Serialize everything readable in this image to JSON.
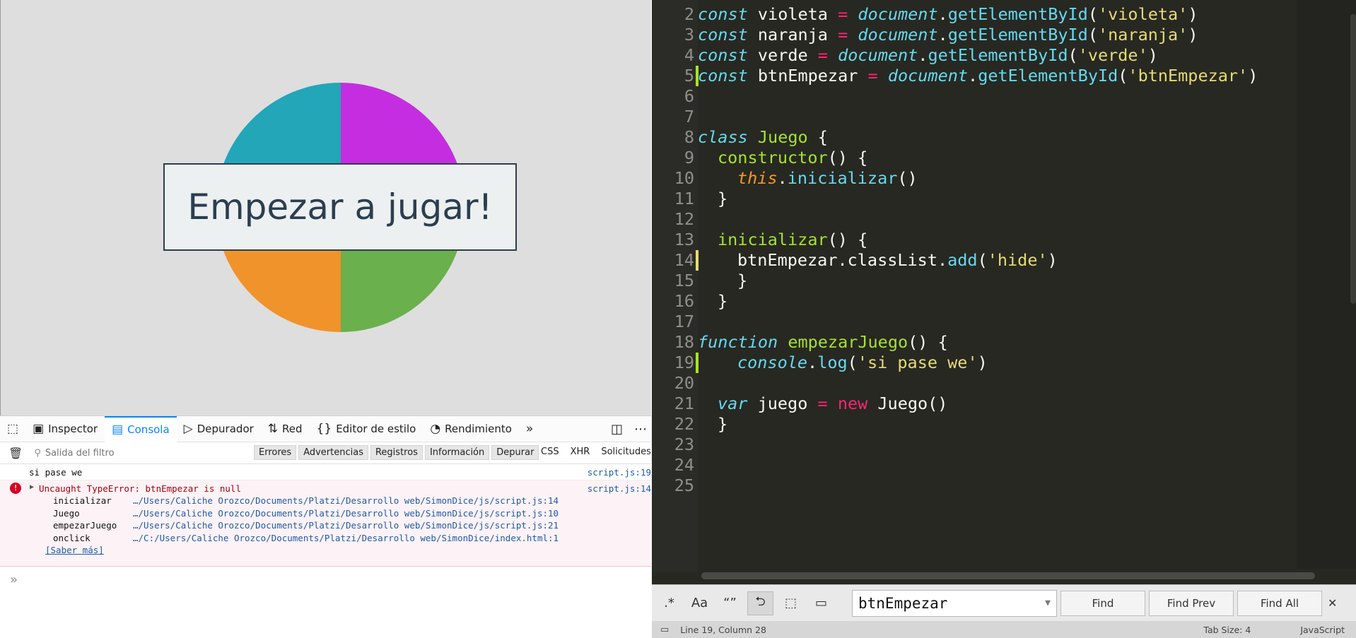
{
  "game": {
    "start_label": "Empezar a jugar!",
    "colors": {
      "celeste": "#22a6b8",
      "violeta": "#c42ee0",
      "naranja": "#f0932b",
      "verde": "#6ab04c"
    }
  },
  "devtools": {
    "tabs": [
      {
        "label": "Inspector",
        "icon": "inspector-icon"
      },
      {
        "label": "Consola",
        "icon": "console-icon"
      },
      {
        "label": "Depurador",
        "icon": "debugger-icon"
      },
      {
        "label": "Red",
        "icon": "network-icon"
      },
      {
        "label": "Editor de estilo",
        "icon": "style-editor-icon"
      },
      {
        "label": "Rendimiento",
        "icon": "performance-icon"
      }
    ],
    "filter_placeholder": "Salida del filtro",
    "levels": [
      "Errores",
      "Advertencias",
      "Registros",
      "Información",
      "Depurar"
    ],
    "request_filters": [
      "CSS",
      "XHR",
      "Solicitudes"
    ],
    "log": {
      "text": "si pase we",
      "source": "script.js:19"
    },
    "error": {
      "message": "Uncaught TypeError: btnEmpezar is null",
      "source": "script.js:14",
      "frames": [
        {
          "fn": "inicializar",
          "path": "…/Users/Caliche Orozco/Documents/Platzi/Desarrollo web/SimonDice/js/script.js:14"
        },
        {
          "fn": "Juego",
          "path": "…/Users/Caliche Orozco/Documents/Platzi/Desarrollo web/SimonDice/js/script.js:10"
        },
        {
          "fn": "empezarJuego",
          "path": "…/Users/Caliche Orozco/Documents/Platzi/Desarrollo web/SimonDice/js/script.js:21"
        },
        {
          "fn": "onclick",
          "path": "…/C:/Users/Caliche Orozco/Documents/Platzi/Desarrollo web/SimonDice/index.html:1"
        }
      ],
      "learn_more": "[Saber más]"
    },
    "prompt": "»"
  },
  "editor": {
    "line_numbers": [
      "2",
      "3",
      "4",
      "5",
      "6",
      "7",
      "8",
      "9",
      "10",
      "11",
      "12",
      "13",
      "14",
      "15",
      "16",
      "17",
      "18",
      "19",
      "20",
      "21",
      "22",
      "23",
      "24",
      "25"
    ],
    "code": {
      "l2": {
        "c": "const",
        "v": " violeta ",
        "eq": "=",
        "doc": "document",
        "dot": ".",
        "m": "getElementById",
        "p1": "(",
        "s": "'violeta'",
        "p2": ")"
      },
      "l3": {
        "c": "const",
        "v": " naranja ",
        "eq": "=",
        "doc": "document",
        "dot": ".",
        "m": "getElementById",
        "p1": "(",
        "s": "'naranja'",
        "p2": ")"
      },
      "l4": {
        "c": "const",
        "v": " verde ",
        "eq": "=",
        "doc": "document",
        "dot": ".",
        "m": "getElementById",
        "p1": "(",
        "s": "'verde'",
        "p2": ")"
      },
      "l5": {
        "c": "const",
        "v": " btnEmpezar ",
        "eq": "=",
        "doc": "document",
        "dot": ".",
        "m": "getElementById",
        "p1": "(",
        "s": "'btnEmpezar'",
        "p2": ")"
      },
      "l8": {
        "k": "class",
        "n": "Juego",
        "r": " {"
      },
      "l9": {
        "f": "constructor",
        "r": "() {"
      },
      "l10": {
        "t": "this",
        "d": ".",
        "m": "inicializar",
        "r": "()"
      },
      "l11": {
        "r": "}"
      },
      "l13": {
        "f": "inicializar",
        "r": "() {"
      },
      "l14": {
        "a": "btnEmpezar.classList.",
        "m": "add",
        "p1": "(",
        "s": "'hide'",
        "p2": ")"
      },
      "l15": {
        "r": "}"
      },
      "l16": {
        "r": "}"
      },
      "l18": {
        "k": "function",
        "n": "empezarJuego",
        "r": "() {"
      },
      "l19": {
        "o": "console",
        "d": ".",
        "m": "log",
        "p1": "(",
        "s": "'si pase we'",
        "p2": ")"
      },
      "l21": {
        "k": "var",
        "v": " juego ",
        "eq": "=",
        "nw": "new",
        "r": " Juego()"
      },
      "l22": {
        "r": "}"
      }
    },
    "find": {
      "value": "btnEmpezar",
      "find_label": "Find",
      "prev_label": "Find Prev",
      "all_label": "Find All"
    },
    "status": {
      "position": "Line 19, Column 28",
      "tab_size": "Tab Size: 4",
      "syntax": "JavaScript"
    }
  }
}
